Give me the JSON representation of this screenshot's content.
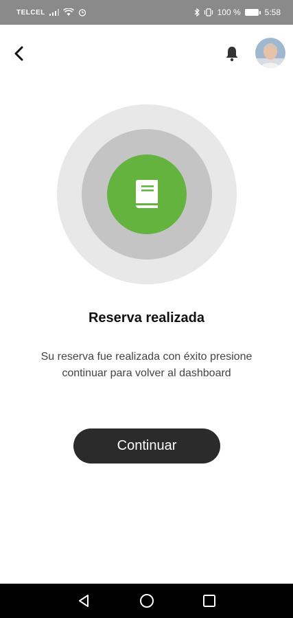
{
  "status_bar": {
    "carrier": "TELCEL",
    "battery": "100 %",
    "time": "5:58"
  },
  "header": {
    "back_icon": "chevron-left-icon",
    "notification_icon": "bell-icon",
    "avatar": "user-avatar"
  },
  "hero": {
    "icon": "book-icon",
    "colors": {
      "outer_ring": "#e8e8e8",
      "middle_ring": "#c4c4c4",
      "inner_circle": "#63b33e"
    }
  },
  "content": {
    "title": "Reserva realizada",
    "message_line1": "Su reserva fue realizada con éxito presione",
    "message_line2": "continuar para volver al dashboard"
  },
  "actions": {
    "continue_label": "Continuar"
  },
  "nav_bar": {
    "back_icon": "triangle-back-icon",
    "home_icon": "circle-home-icon",
    "recents_icon": "square-recents-icon"
  }
}
